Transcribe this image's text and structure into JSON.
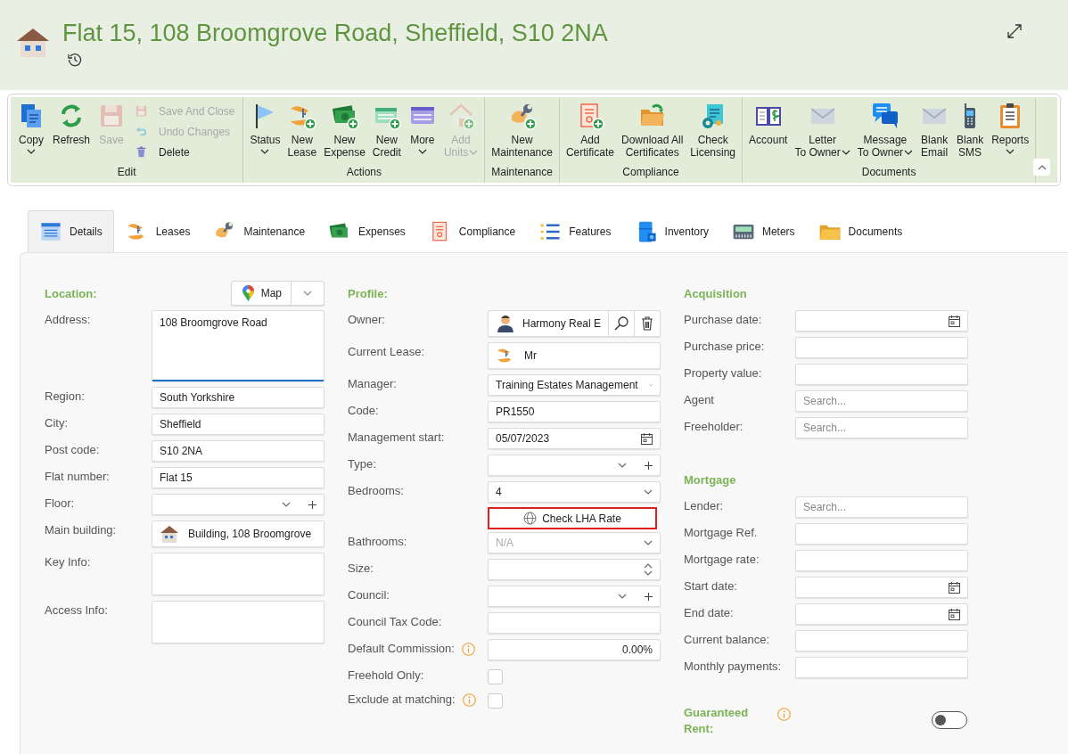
{
  "header": {
    "title": "Flat 15, 108 Broomgrove Road, Sheffield, S10 2NA"
  },
  "ribbon": {
    "groups": [
      {
        "label": "Edit",
        "items": [
          {
            "kind": "large",
            "lines": [
              "Copy"
            ],
            "dropdown": true,
            "disabled": false
          },
          {
            "kind": "large",
            "lines": [
              "Refresh"
            ],
            "dropdown": false,
            "disabled": false
          },
          {
            "kind": "large",
            "lines": [
              "Save"
            ],
            "dropdown": false,
            "disabled": true
          },
          {
            "kind": "small",
            "lines": [
              "Save And Close"
            ],
            "dropdown": false,
            "disabled": true
          },
          {
            "kind": "small",
            "lines": [
              "Undo Changes"
            ],
            "dropdown": false,
            "disabled": true
          },
          {
            "kind": "small",
            "lines": [
              "Delete"
            ],
            "dropdown": false,
            "disabled": false
          }
        ]
      },
      {
        "label": "Actions",
        "items": [
          {
            "kind": "large",
            "lines": [
              "Status"
            ],
            "dropdown": true,
            "disabled": false
          },
          {
            "kind": "large",
            "lines": [
              "New",
              "Lease"
            ],
            "dropdown": false,
            "disabled": false
          },
          {
            "kind": "large",
            "lines": [
              "New",
              "Expense"
            ],
            "dropdown": false,
            "disabled": false
          },
          {
            "kind": "large",
            "lines": [
              "New",
              "Credit"
            ],
            "dropdown": false,
            "disabled": false
          },
          {
            "kind": "large",
            "lines": [
              "More"
            ],
            "dropdown": true,
            "disabled": false
          },
          {
            "kind": "large",
            "lines": [
              "Add",
              "Units"
            ],
            "dropdown": true,
            "disabled": true
          }
        ]
      },
      {
        "label": "Maintenance",
        "items": [
          {
            "kind": "large",
            "lines": [
              "New",
              "Maintenance"
            ],
            "dropdown": false,
            "disabled": false
          }
        ]
      },
      {
        "label": "Compliance",
        "items": [
          {
            "kind": "large",
            "lines": [
              "Add",
              "Certificate"
            ],
            "dropdown": false,
            "disabled": false
          },
          {
            "kind": "large",
            "lines": [
              "Download All",
              "Certificates"
            ],
            "dropdown": false,
            "disabled": false
          },
          {
            "kind": "large",
            "lines": [
              "Check",
              "Licensing"
            ],
            "dropdown": false,
            "disabled": false
          }
        ]
      },
      {
        "label": "Documents",
        "items": [
          {
            "kind": "large",
            "lines": [
              "Account"
            ],
            "dropdown": false,
            "disabled": false
          },
          {
            "kind": "large",
            "lines": [
              "Letter",
              "To Owner"
            ],
            "dropdown": true,
            "disabled": false
          },
          {
            "kind": "large",
            "lines": [
              "Message",
              "To Owner"
            ],
            "dropdown": true,
            "disabled": false
          },
          {
            "kind": "large",
            "lines": [
              "Blank",
              "Email"
            ],
            "dropdown": false,
            "disabled": false
          },
          {
            "kind": "large",
            "lines": [
              "Blank",
              "SMS"
            ],
            "dropdown": false,
            "disabled": false
          },
          {
            "kind": "large",
            "lines": [
              "Reports"
            ],
            "dropdown": true,
            "disabled": false
          }
        ]
      }
    ]
  },
  "tabs": [
    {
      "label": "Details",
      "selected": true
    },
    {
      "label": "Leases",
      "selected": false
    },
    {
      "label": "Maintenance",
      "selected": false
    },
    {
      "label": "Expenses",
      "selected": false
    },
    {
      "label": "Compliance",
      "selected": false
    },
    {
      "label": "Features",
      "selected": false
    },
    {
      "label": "Inventory",
      "selected": false
    },
    {
      "label": "Meters",
      "selected": false
    },
    {
      "label": "Documents",
      "selected": false
    }
  ],
  "location": {
    "heading": "Location:",
    "map_button": "Map",
    "fields": [
      {
        "kind": "textarea",
        "label": "Address:",
        "value": "108 Broomgrove Road",
        "focused": true
      },
      {
        "kind": "text",
        "label": "Region:",
        "value": "South Yorkshire"
      },
      {
        "kind": "text",
        "label": "City:",
        "value": "Sheffield"
      },
      {
        "kind": "text",
        "label": "Post code:",
        "value": "S10 2NA"
      },
      {
        "kind": "text",
        "label": "Flat number:",
        "value": "Flat 15"
      },
      {
        "kind": "select-add",
        "label": "Floor:"
      },
      {
        "kind": "building",
        "label": "Main building:",
        "value": "Building, 108 Broomgrove"
      },
      {
        "kind": "textarea",
        "label": "Key Info:"
      },
      {
        "kind": "textarea",
        "label": "Access Info:"
      }
    ]
  },
  "profile": {
    "heading": "Profile:",
    "fields": [
      {
        "kind": "owner",
        "label": "Owner:",
        "value": "Harmony Real E"
      },
      {
        "kind": "lease",
        "label": "Current Lease:",
        "value": "Mr"
      },
      {
        "kind": "select",
        "label": "Manager:",
        "value": "Training Estates Management"
      },
      {
        "kind": "text",
        "label": "Code:",
        "value": "PR1550"
      },
      {
        "kind": "date",
        "label": "Management start:",
        "value": "05/07/2023"
      },
      {
        "kind": "select-add",
        "label": "Type:"
      },
      {
        "kind": "select",
        "label": "Bedrooms:",
        "value": "4"
      },
      {
        "kind": "button",
        "label": "Check LHA Rate",
        "highlighted": true
      },
      {
        "kind": "select",
        "label": "Bathrooms:",
        "value": "N/A",
        "disabled": true
      },
      {
        "kind": "spin",
        "label": "Size:"
      },
      {
        "kind": "select-add",
        "label": "Council:"
      },
      {
        "kind": "text",
        "label": "Council Tax Code:"
      },
      {
        "kind": "number",
        "label": "Default Commission:",
        "value": "0.00%",
        "info": true
      },
      {
        "kind": "checkbox",
        "label": "Freehold Only:",
        "checked": false
      },
      {
        "kind": "checkbox",
        "label": "Exclude at matching:",
        "checked": false,
        "info": true
      }
    ]
  },
  "acquisition": {
    "heading": "Acquisition",
    "fields": [
      {
        "kind": "date",
        "label": "Purchase date:"
      },
      {
        "kind": "text",
        "label": "Purchase price:"
      },
      {
        "kind": "text",
        "label": "Property value:"
      },
      {
        "kind": "text",
        "label": "Agent",
        "placeholder": "Search..."
      },
      {
        "kind": "text",
        "label": "Freeholder:",
        "placeholder": "Search..."
      }
    ]
  },
  "mortgage": {
    "heading": "Mortgage",
    "fields": [
      {
        "kind": "text",
        "label": "Lender:",
        "placeholder": "Search..."
      },
      {
        "kind": "text",
        "label": "Mortgage Ref."
      },
      {
        "kind": "text",
        "label": "Mortgage rate:"
      },
      {
        "kind": "date",
        "label": "Start date:"
      },
      {
        "kind": "date",
        "label": "End date:"
      },
      {
        "kind": "text",
        "label": "Current balance:"
      },
      {
        "kind": "text",
        "label": "Monthly payments:"
      }
    ]
  },
  "guaranteed_rent": {
    "label": "Guaranteed Rent:",
    "info": true,
    "on": false
  }
}
